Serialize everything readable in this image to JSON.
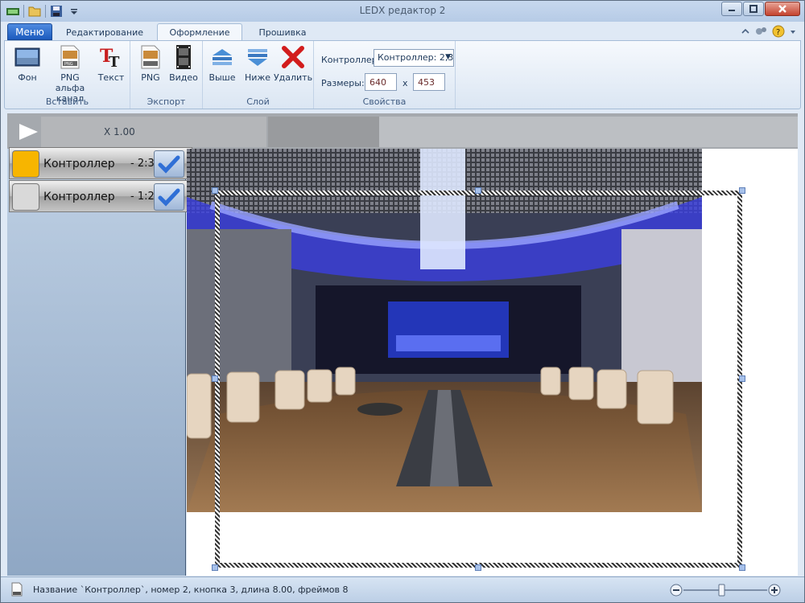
{
  "window": {
    "title": "LEDX редактор 2"
  },
  "tabs": {
    "menu": "Меню",
    "items": [
      {
        "label": "Редактирование"
      },
      {
        "label": "Оформление"
      },
      {
        "label": "Прошивка"
      }
    ]
  },
  "ribbon": {
    "insert": {
      "label": "Вставить",
      "fon": "Фон",
      "png_alpha_1": "PNG альфа",
      "png_alpha_2": "канал",
      "text": "Текст"
    },
    "export": {
      "label": "Экспорт",
      "png": "PNG",
      "video": "Видео"
    },
    "layer": {
      "label": "Слой",
      "up": "Выше",
      "down": "Ниже",
      "delete": "Удалить"
    },
    "props": {
      "label": "Свойства",
      "controller_label": "Контроллер",
      "controller_value": "Контроллер: 2,3",
      "size_label": "Размеры:",
      "width": "640",
      "x": "x",
      "height": "453"
    }
  },
  "timeline": {
    "zoom": "X 1.00"
  },
  "layers": [
    {
      "name": "Контроллер",
      "num": "- 2:3",
      "color": "#f7b500"
    },
    {
      "name": "Контроллер",
      "num": "- 1:2",
      "color": "#d9d9d9"
    }
  ],
  "status": {
    "text": "Название `Контроллер`, номер 2, кнопка 3, длина 8.00, фреймов 8"
  },
  "colors": {
    "accent": "#1c5bbd"
  }
}
